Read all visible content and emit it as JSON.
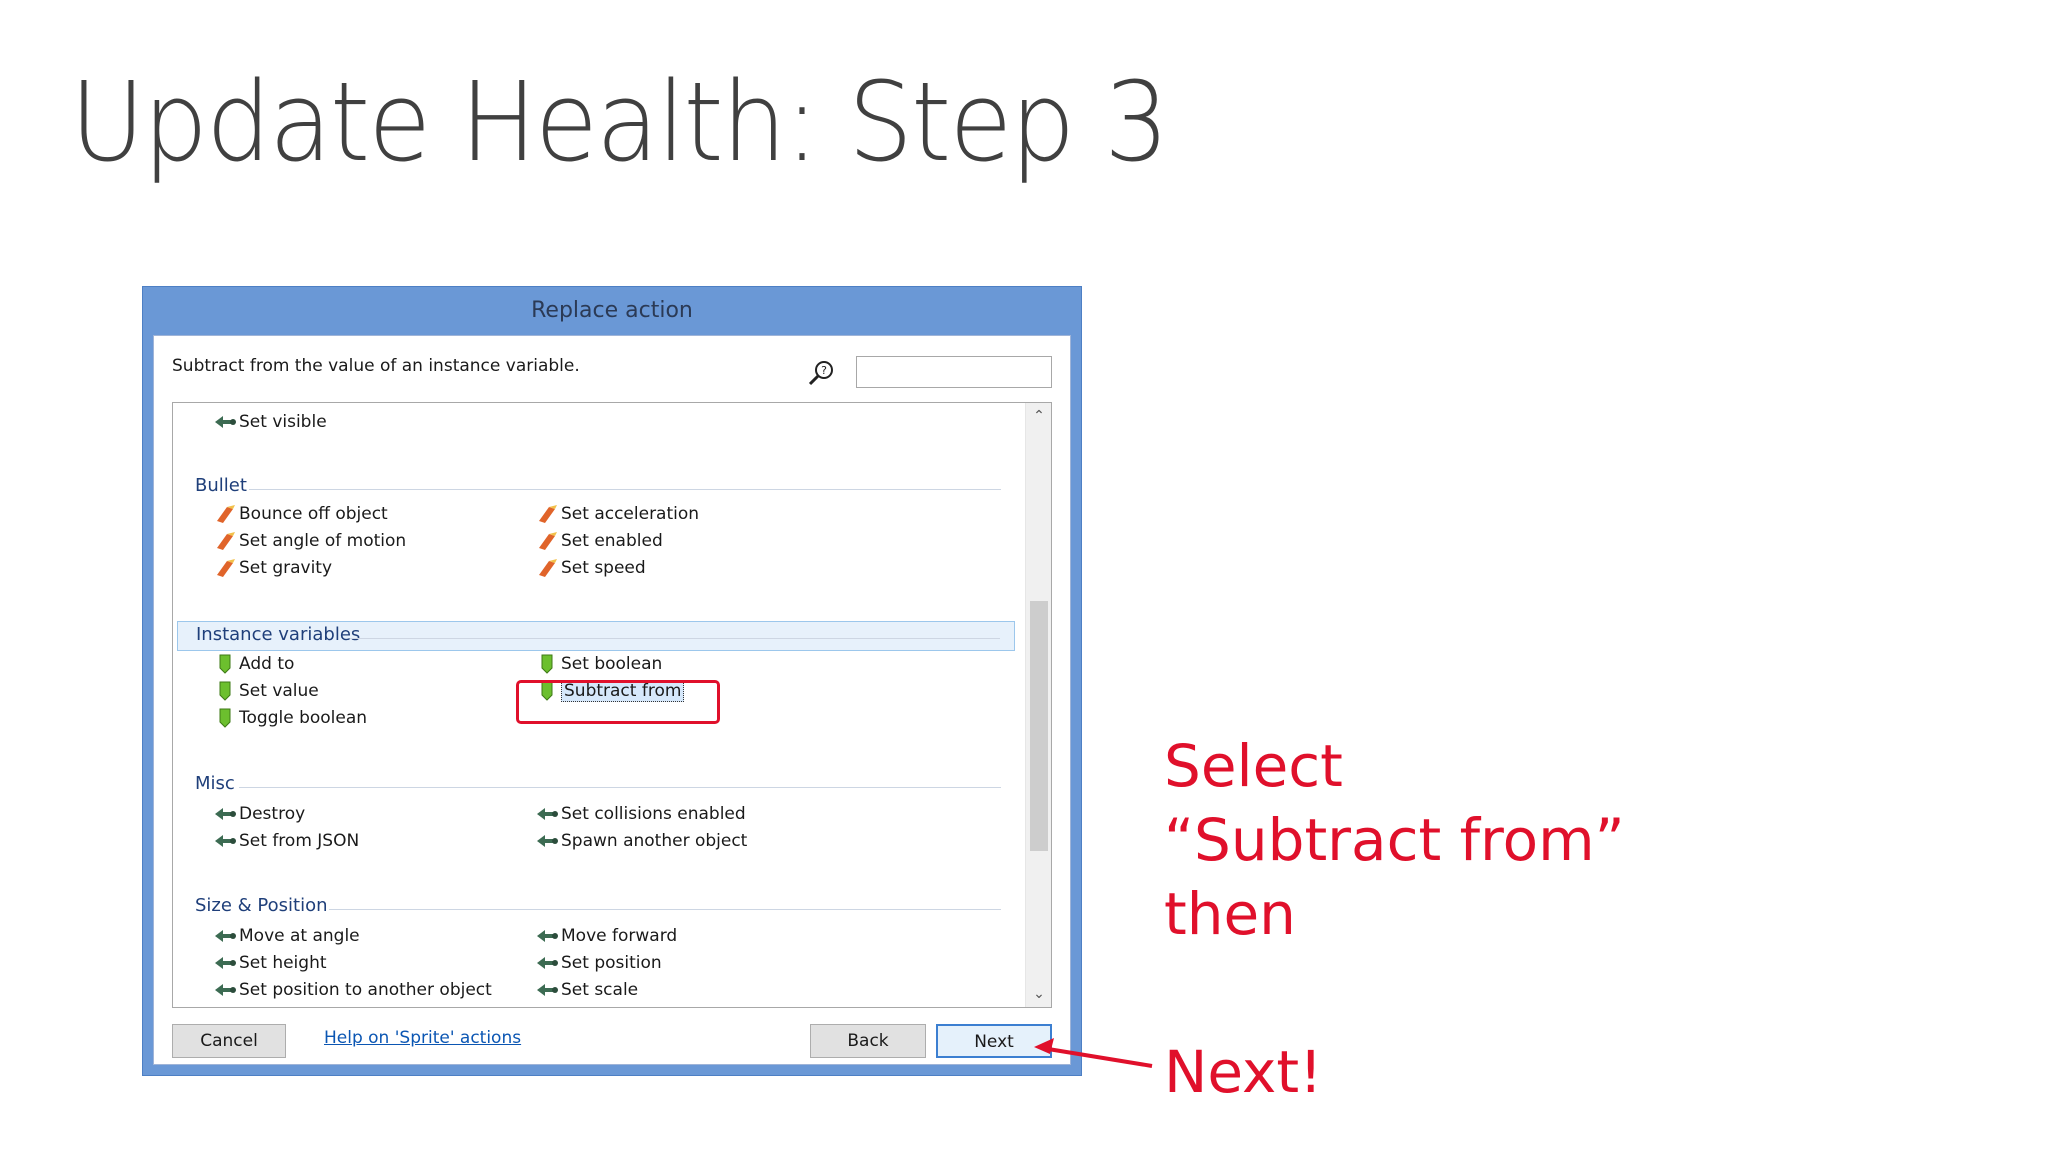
{
  "slide": {
    "title": "Update Health: Step 3"
  },
  "dialog": {
    "title": "Replace action",
    "description": "Subtract from the value of an instance variable.",
    "search": {
      "value": "",
      "placeholder": ""
    },
    "groups": [
      {
        "label": "Bullet"
      },
      {
        "label": "Instance variables"
      },
      {
        "label": "Misc"
      },
      {
        "label": "Size & Position"
      }
    ],
    "items": {
      "set_visible": "Set visible",
      "bounce_off_object": "Bounce off object",
      "set_angle_of_motion": "Set angle of motion",
      "set_gravity": "Set gravity",
      "set_acceleration": "Set acceleration",
      "set_enabled": "Set enabled",
      "set_speed": "Set speed",
      "add_to": "Add to",
      "set_value": "Set value",
      "toggle_boolean": "Toggle boolean",
      "set_boolean": "Set boolean",
      "subtract_from": "Subtract from",
      "destroy": "Destroy",
      "set_from_json": "Set from JSON",
      "set_collisions_enabled": "Set collisions enabled",
      "spawn_another_object": "Spawn another object",
      "move_at_angle": "Move at angle",
      "set_height": "Set height",
      "set_position_to_another_object": "Set position to another object",
      "move_forward": "Move forward",
      "set_position": "Set position",
      "set_scale": "Set scale"
    },
    "buttons": {
      "cancel": "Cancel",
      "help": "Help on 'Sprite' actions",
      "back": "Back",
      "next": "Next"
    }
  },
  "annotation": {
    "line1": "Select",
    "line2": "“Subtract from”",
    "line3": "then",
    "line4": "Next!"
  },
  "colors": {
    "accent": "#e0102b",
    "dialog_frame": "#6a98d6"
  }
}
